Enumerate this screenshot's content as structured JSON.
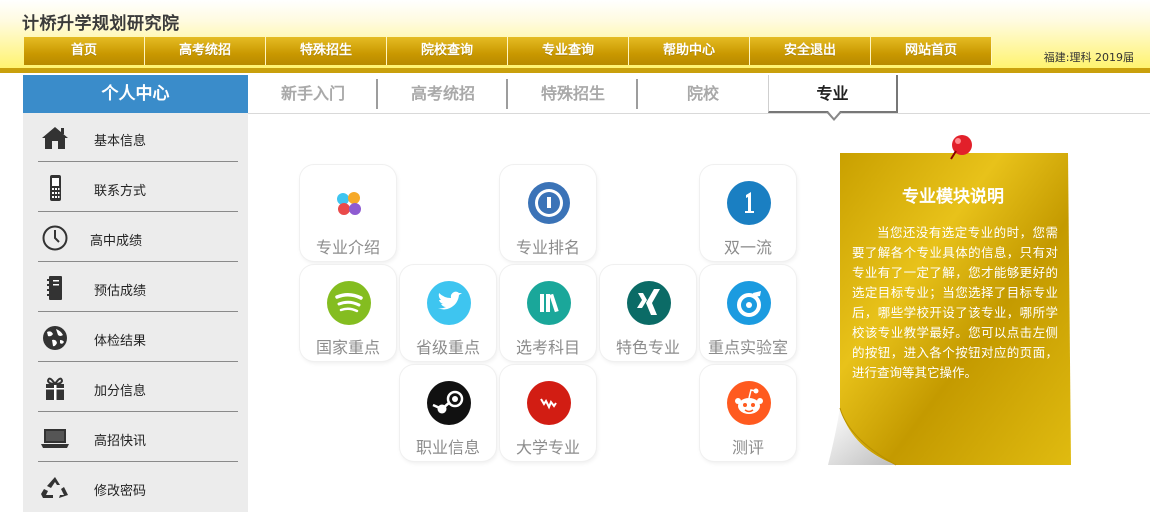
{
  "header": {
    "site_title": "计桥升学规划研究院",
    "user_info": "福建:理科 2019届",
    "nav": [
      {
        "label": "首页"
      },
      {
        "label": "高考统招"
      },
      {
        "label": "特殊招生"
      },
      {
        "label": "院校查询"
      },
      {
        "label": "专业查询"
      },
      {
        "label": "帮助中心"
      },
      {
        "label": "安全退出"
      },
      {
        "label": "网站首页"
      }
    ]
  },
  "sidebar": {
    "title": "个人中心",
    "items": [
      {
        "label": "基本信息",
        "icon": "home-icon"
      },
      {
        "label": "联系方式",
        "icon": "mobile-phone-icon"
      },
      {
        "label": "高中成绩",
        "icon": "clock-icon"
      },
      {
        "label": "预估成绩",
        "icon": "notebook-icon"
      },
      {
        "label": "体检结果",
        "icon": "globe-icon"
      },
      {
        "label": "加分信息",
        "icon": "gift-icon"
      },
      {
        "label": "高招快讯",
        "icon": "laptop-icon"
      },
      {
        "label": "修改密码",
        "icon": "recycle-icon"
      }
    ]
  },
  "tabs": [
    {
      "label": "新手入门"
    },
    {
      "label": "高考统招"
    },
    {
      "label": "特殊招生"
    },
    {
      "label": "院校"
    },
    {
      "label": "专业"
    }
  ],
  "active_tab": "专业",
  "tiles": [
    {
      "label": "专业介绍",
      "icon": "color-dots-icon"
    },
    {
      "label": "专业排名",
      "icon": "ring-icon"
    },
    {
      "label": "双一流",
      "icon": "number-one-icon"
    },
    {
      "label": "国家重点",
      "icon": "spotify-icon"
    },
    {
      "label": "省级重点",
      "icon": "twitter-bird-icon"
    },
    {
      "label": "选考科目",
      "icon": "books-icon"
    },
    {
      "label": "特色专业",
      "icon": "xing-icon"
    },
    {
      "label": "重点实验室",
      "icon": "music-note-icon"
    },
    {
      "label": "职业信息",
      "icon": "steam-icon"
    },
    {
      "label": "大学专业",
      "icon": "last-fm-icon"
    },
    {
      "label": "测评",
      "icon": "reddit-alien-icon"
    }
  ],
  "note": {
    "title": "专业模块说明",
    "text": "当您还没有选定专业的时，您需要了解各个专业具体的信息，只有对专业有了一定了解，您才能够更好的选定目标专业；当您选择了目标专业后，哪些学校开设了该专业，哪所学校该专业教学最好。您可以点击左侧的按钮，进入各个按钮对应的页面，进行查询等其它操作。"
  },
  "colors": {
    "accent_blue": "#3a8cca",
    "nav_gold": "#c99800",
    "note_gold": "#d7b000"
  }
}
